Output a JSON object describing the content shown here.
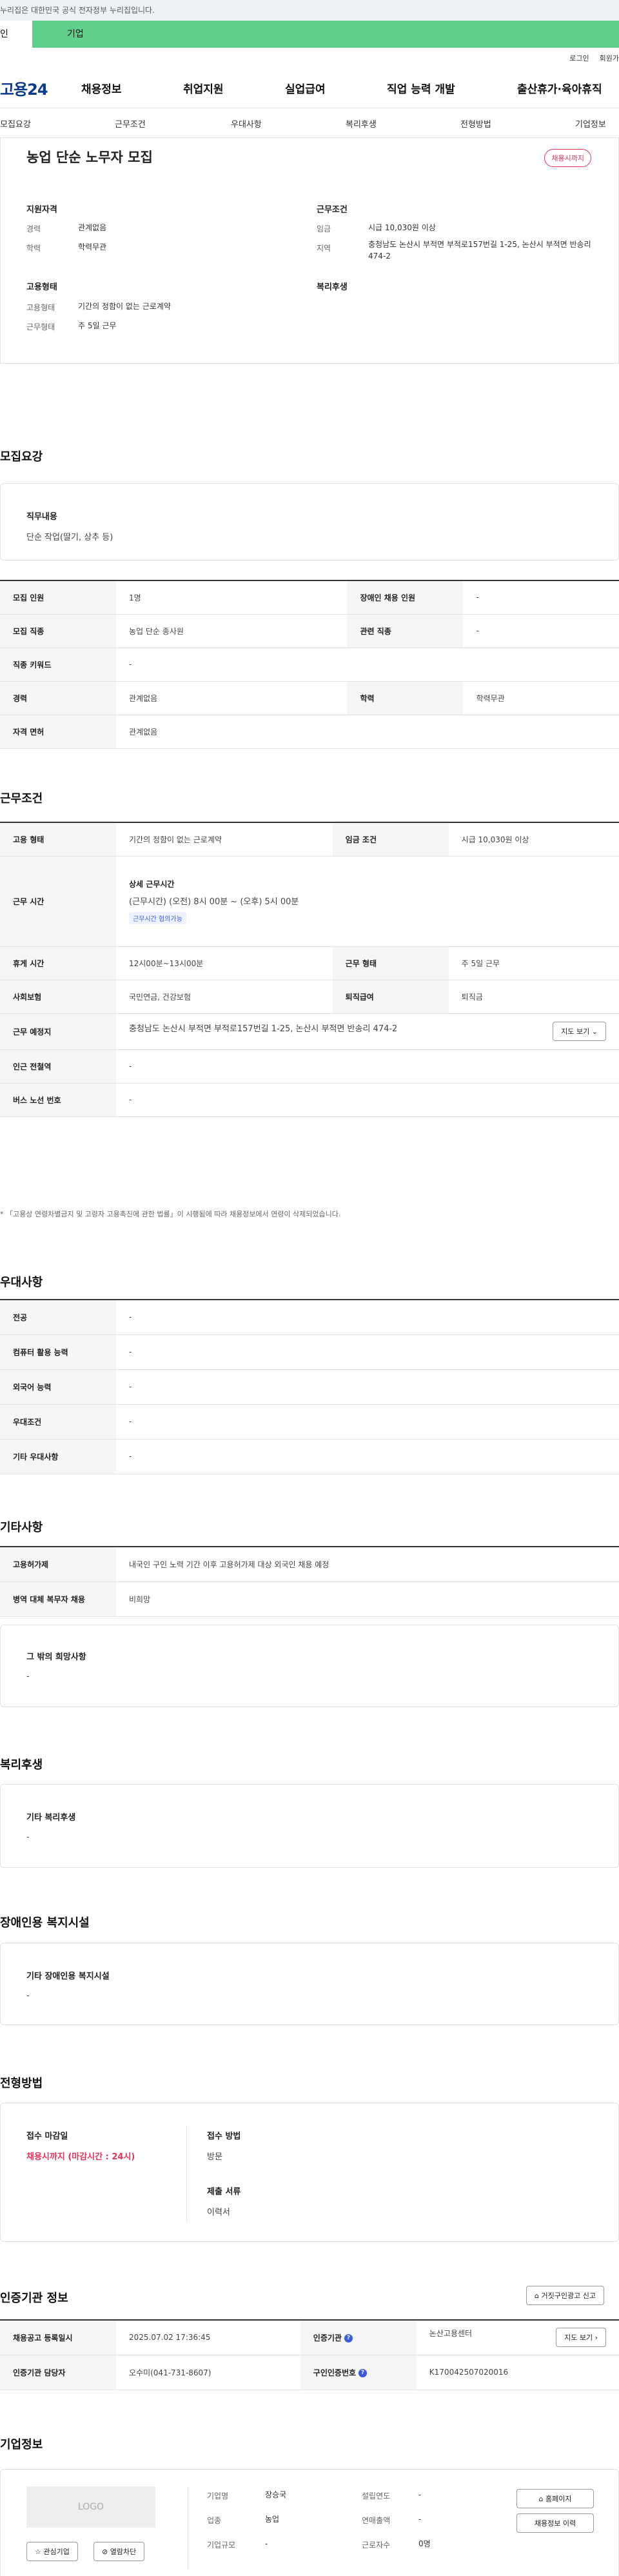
{
  "gov_banner": "누리집은 대한민국 공식 전자정부 누리집입니다.",
  "user_tabs": [
    "인",
    "기업"
  ],
  "util_links": [
    "로그인",
    "회원가"
  ],
  "logo": "고용24",
  "gnb": [
    "채용정보",
    "취업지원",
    "실업급여",
    "직업 능력 개발",
    "출산휴가·육아휴직"
  ],
  "sub_tabs": [
    "모집요강",
    "근무조건",
    "우대사항",
    "복리후생",
    "전형방법",
    "기업정보"
  ],
  "hero": {
    "title": "농업 단순 노무자 모집",
    "status": "채용시까지",
    "qual_h": "지원자격",
    "cond_h": "근무조건",
    "emp_h": "고용형태",
    "welfare_h": "복리후생",
    "career_k": "경력",
    "career_v": "관계없음",
    "edu_k": "학력",
    "edu_v": "학력무관",
    "wage_k": "임금",
    "wage_v": "시급 10,030원 이상",
    "region_k": "지역",
    "region_v": "충청남도 논산시 부적면 부적로157번길 1-25, 논산시 부적면 반송리 474-2",
    "emptype_k": "고용형태",
    "emptype_v": "기간의 정함이 없는 근로계약",
    "worktype_k": "근무형태",
    "worktype_v": "주 5일 근무"
  },
  "recruit": {
    "title": "모집요강",
    "duty_h": "직무내용",
    "duty_v": "단순 작업(딸기, 상추 등)",
    "rows": {
      "count_k": "모집 인원",
      "count_v": "1명",
      "disabled_k": "장애인 채용 인원",
      "disabled_v": "-",
      "job_k": "모집 직종",
      "job_v": "농업 단순 종사원",
      "related_k": "관련 직종",
      "related_v": "-",
      "kw_k": "직종 키워드",
      "kw_v": "-",
      "career_k": "경력",
      "career_v": "관계없음",
      "edu_k": "학력",
      "edu_v": "학력무관",
      "lic_k": "자격 면허",
      "lic_v": "관계없음"
    }
  },
  "conditions": {
    "title": "근무조건",
    "emp_k": "고용 형태",
    "emp_v": "기간의 정함이 없는 근로계약",
    "wage_k": "임금 조건",
    "wage_v": "시급 10,030원 이상",
    "time_k": "근무 시간",
    "time_h": "상세 근무시간",
    "time_v": "(근무시간) (오전) 8시 00분 ~ (오후) 5시 00분",
    "time_tag": "근무시간 협의가능",
    "rest_k": "휴게 시간",
    "rest_v": "12시00분~13시00분",
    "type_k": "근무 형태",
    "type_v": "주 5일 근무",
    "ins_k": "사회보험",
    "ins_v": "국민연금, 건강보험",
    "ret_k": "퇴직급여",
    "ret_v": "퇴직금",
    "place_k": "근무 예정지",
    "place_v": "충청남도 논산시 부적면 부적로157번길 1-25, 논산시 부적면 반송리 474-2",
    "map_btn": "지도 보기",
    "subway_k": "인근 전철역",
    "subway_v": "-",
    "bus_k": "버스 노선 번호",
    "bus_v": "-",
    "note": "* 「고용상 연령차별금지 및 고령자 고용촉진에 관한 법률」이 시행됨에 따라 채용정보에서 연령이 삭제되었습니다."
  },
  "pref": {
    "title": "우대사항",
    "major_k": "전공",
    "major_v": "-",
    "pc_k": "컴퓨터 활용 능력",
    "pc_v": "-",
    "lang_k": "외국어 능력",
    "lang_v": "-",
    "cond_k": "우대조건",
    "cond_v": "-",
    "etc_k": "기타 우대사항",
    "etc_v": "-"
  },
  "etc": {
    "title": "기타사항",
    "permit_k": "고용허가제",
    "permit_v": "내국인 구인 노력 기간 이후 고용허가제 대상 외국인 채용 예정",
    "mil_k": "병역 대체 복무자 채용",
    "mil_v": "비희망",
    "hope_h": "그 밖의 희망사항",
    "hope_v": "-"
  },
  "welfare": {
    "title": "복리후생",
    "h": "기타 복리후생",
    "v": "-"
  },
  "disabled": {
    "title": "장애인용 복지시설",
    "h": "기타 장애인용 복지시설",
    "v": "-"
  },
  "selection": {
    "title": "전형방법",
    "deadline_h": "접수 마감일",
    "deadline_v": "채용시까지 (마감시간 : 24시)",
    "method_h": "접수 방법",
    "method_v": "방문",
    "docs_h": "제출 서류",
    "docs_v": "이력서"
  },
  "cert": {
    "title": "인증기관 정보",
    "report_btn": "거짓구인광고 신고",
    "reg_k": "채용공고 등록일시",
    "reg_v": "2025.07.02 17:36:45",
    "org_k": "인증기관",
    "org_v": "논산고용센터",
    "map_btn": "지도 보기",
    "mgr_k": "인증기관 담당자",
    "mgr_v": "오수미(041-731-8607)",
    "no_k": "구인인증번호",
    "no_v": "K170042507020016"
  },
  "company": {
    "title": "기업정보",
    "logo": "LOGO",
    "fav_btn": "관심기업",
    "block_btn": "열람차단",
    "name_k": "기업명",
    "name_v": "장승국",
    "industry_k": "업종",
    "industry_v": "농업",
    "size_k": "기업규모",
    "size_v": "-",
    "year_k": "설립연도",
    "year_v": "-",
    "sales_k": "연매출액",
    "sales_v": "-",
    "staff_k": "근로자수",
    "staff_v": "0명",
    "home_btn": "홈페이지",
    "history_btn": "채용정보 이력"
  }
}
